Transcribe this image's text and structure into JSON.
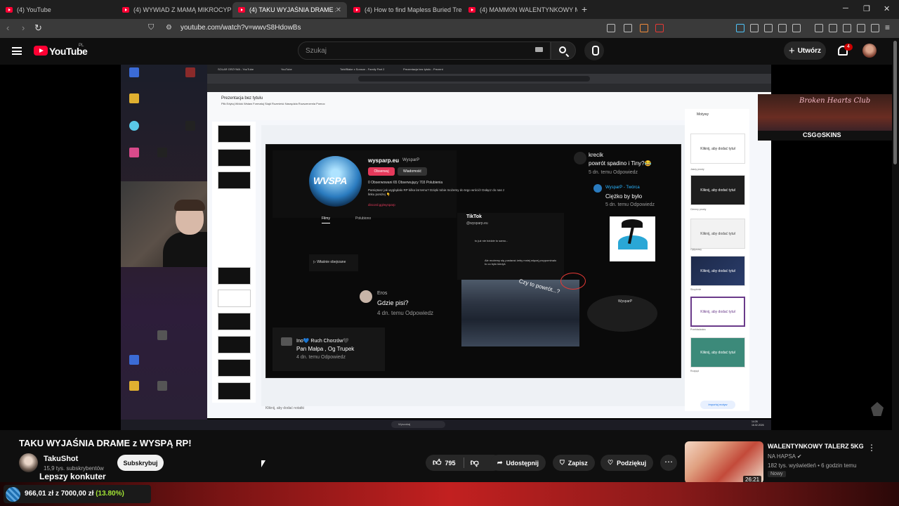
{
  "browser": {
    "tabs": [
      {
        "title": "(4) YouTube"
      },
      {
        "title": "(4) WYWIAD Z MAMĄ MIKROCYPKA"
      },
      {
        "title": "(4) TAKU WYJAŚNIA DRAME z"
      },
      {
        "title": "(4) How to find Mapless Buried Treas"
      },
      {
        "title": "(4) MAMM0N WALENTYNKOWY MIX"
      }
    ],
    "new_tab": "+",
    "url": "youtube.com/watch?v=wwvS8HdowBs"
  },
  "youtube": {
    "logo_text": "YouTube",
    "country_code": "PL",
    "search_placeholder": "Szukaj",
    "create_label": "Utwórz",
    "notifications_count": "4"
  },
  "video": {
    "inner_tabs": [
      "SOLAR GRZYWA - YouTube",
      "YouTube",
      "Tobi/Blake x Sonson - Family Part 2",
      "Prezentacja bez tytułu - Prezent"
    ],
    "slides_title": "Prezentacja bez tytułu",
    "slides_menu": "Plik  Edytuj  Widok  Wstaw  Formatuj  Slajd  Rozmieść  Narzędzia  Rozszerzenia  Pomoc",
    "profile": {
      "logo": "WVSPA",
      "name": "wysparp.eu",
      "handle": "WysparP",
      "follow": "Obserwuj",
      "message": "Wiadomość",
      "stats": "0 Obserwowani   65 Obserwujący   703 Polubienia",
      "desc": "Pamiętasz jak wyglądało RP kilka lat temu? Dzięki tobie możemy do tego wrócić! Dołącz do nas z linku poniżej 👇",
      "link": "discord.gg/wysparp",
      "tab_films": "Filmy",
      "tab_liked": "Polubiono",
      "watched": "▷ Właśnie obejrzane"
    },
    "comments": [
      {
        "name": "krecik",
        "text": "powrót spadino i Tiny?😂",
        "meta": "5 dn. temu   Odpowiedz"
      },
      {
        "name": "WysparP - Twórca",
        "text": "Ciężko by było",
        "meta": "5 dn. temu   Odpowiedz"
      },
      {
        "name": "Eros",
        "text": "Gdzie pisi?",
        "meta": "4 dn. temu   Odpowiedz"
      },
      {
        "name": "Ino💙 Ruch Chorzów🖤",
        "text": "Pan Małpa , Og Trupek",
        "meta": "4 dn. temu   Odpowiedz"
      }
    ],
    "tiktok": {
      "logo": "TikTok",
      "handle": "@wysparp.eu",
      "c1": "to już nie bździe to samo...",
      "c2": "Ale możemy się postarać żeby mniej więcej przypominało to co było kiedyś",
      "crowd_text": "Czy to powrót...?"
    },
    "ghost_label": "WysparP",
    "themes_title": "Motywy",
    "themes": [
      "Kliknij, aby dodać tytuł",
      "Kliknij, aby dodać tytuł",
      "Kliknij, aby dodać tytuł",
      "Kliknij, aby dodać tytuł",
      "Kliknij, aby dodać tytuł",
      "Kliknij, aby dodać tytuł"
    ],
    "theme_labels": [
      "Jasny prosty",
      "Ciemny prosty",
      "Opływowy",
      "Skupienie",
      "Przekładaniec",
      "Rozpęd"
    ],
    "import_theme": "Importuj motyw",
    "notes": "Kliknij, aby dodać notatki",
    "taskbar_search": "Wyszukaj",
    "taskbar_time": "14:26\n16.02.2026",
    "overlay_banner_title": "Broken Hearts Club",
    "overlay_banner_sponsor": "CSG⊙SKINS"
  },
  "watch": {
    "title": "TAKU WYJAŚNIA DRAME z WYSPĄ RP!",
    "channel": "TakuShot",
    "subs": "15,9 tys. subskrybentów",
    "subscribe": "Subskrybuj",
    "overlay_text": "Lepszy konkuter",
    "likes": "795",
    "share": "Udostępnij",
    "save": "Zapisz",
    "thanks": "Podziękuj",
    "more": "⋯"
  },
  "recommendation": {
    "title": "WALENTYNKOWY TALERZ 5KG",
    "channel": "NA HAPSA",
    "meta": "182 tys. wyświetleń • 6 godzin temu",
    "badge": "Nowy",
    "duration": "26:21"
  },
  "stream_goal": {
    "current": "966,01 zł",
    "separator": "z",
    "target": "7000,00 zł",
    "percent": "(13.80%)"
  },
  "colors": {
    "youtube_red": "#ff0033",
    "accent_pink": "#e5395b",
    "goal_green": "#a3e635"
  }
}
